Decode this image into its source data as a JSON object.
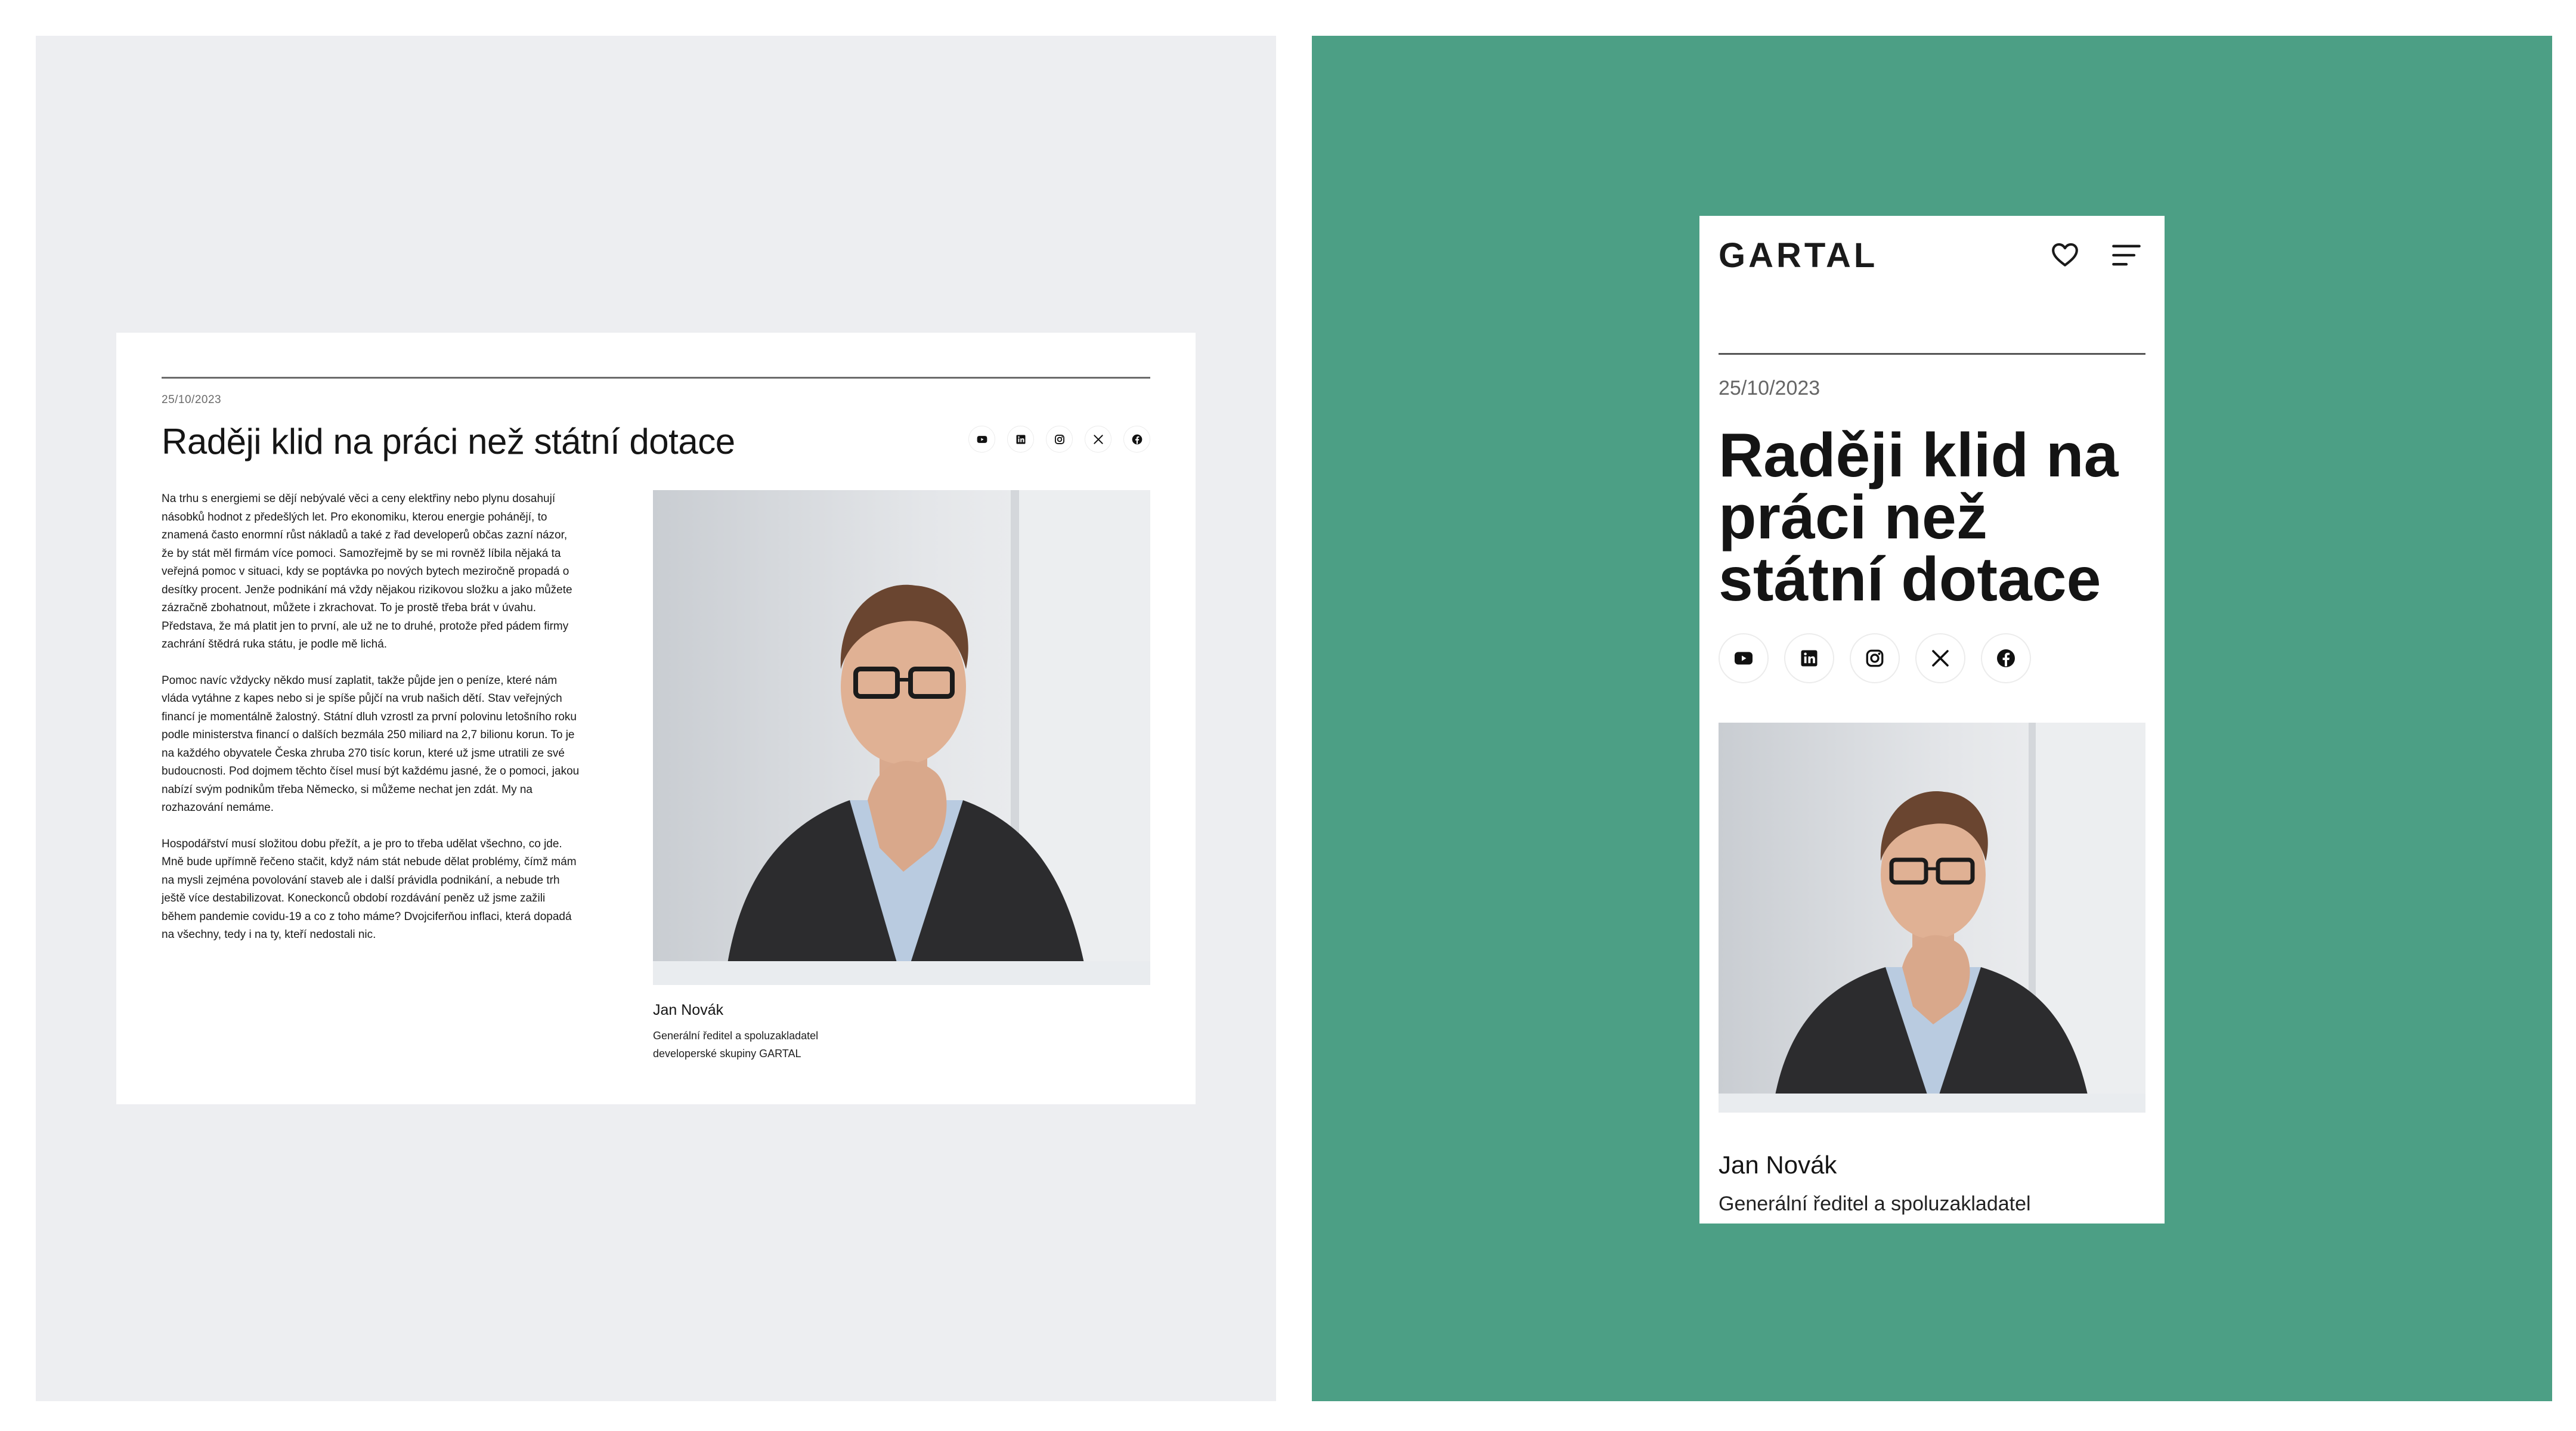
{
  "desktop": {
    "date": "25/10/2023",
    "title": "Raději klid na práci než státní dotace",
    "social": [
      "youtube-icon",
      "linkedin-icon",
      "instagram-icon",
      "x-icon",
      "facebook-icon"
    ],
    "paragraphs": [
      "Na trhu s energiemi se dějí nebývalé věci a ceny elektřiny nebo plynu dosahují násobků hodnot z předešlých let. Pro ekonomiku, kterou energie pohánějí, to znamená často enormní růst nákladů a také z řad developerů občas zazní názor, že by stát měl firmám více pomoci. Samozřejmě by se mi rovněž líbila nějaká ta veřejná pomoc v situaci, kdy se poptávka po nových bytech meziročně propadá o desítky procent. Jenže podnikání má vždy nějakou rizikovou složku a jako můžete zázračně zbohatnout, můžete i zkrachovat. To je prostě třeba brát v úvahu. Představa, že má platit jen to první, ale už ne to druhé, protože před pádem firmy zachrání štědrá ruka státu, je podle mě lichá.",
      "Pomoc navíc vždycky někdo musí zaplatit, takže půjde jen o peníze, které nám vláda vytáhne z kapes nebo si je spíše půjčí na vrub našich dětí. Stav veřejných financí je momentálně žalostný. Státní dluh vzrostl za první polovinu letošního roku podle ministerstva financí o dalších bezmála 250 miliard na 2,7 bilionu korun. To je na každého obyvatele Česka zhruba 270 tisíc korun, které už jsme utratili ze své budoucnosti. Pod dojmem těchto čísel musí být každému jasné, že o pomoci, jakou nabízí svým podnikům třeba Německo, si můžeme nechat jen zdát. My na rozhazování nemáme.",
      "Hospodářství musí složitou dobu přežít, a je pro to třeba udělat všechno, co jde. Mně bude upřímně řečeno stačit, když nám stát nebude dělat problémy, čímž mám na mysli zejména povolování staveb ale i další právidla podnikání, a nebude trh ještě více destabilizovat. Koneckonců období rozdávání peněz už jsme zažili během pandemie covidu-19 a co z toho máme? Dvojciferňou inflaci, která dopadá na všechny, tedy i na ty, kteří nedostali nic."
    ],
    "author_name": "Jan Novák",
    "author_role": "Generální ředitel a spoluzakladatel developerské skupiny GARTAL"
  },
  "mobile": {
    "logo": "GARTAL",
    "date": "25/10/2023",
    "title": "Raději klid na práci než státní dotace",
    "social": [
      "youtube-icon",
      "linkedin-icon",
      "instagram-icon",
      "x-icon",
      "facebook-icon"
    ],
    "author_name": "Jan Novák",
    "author_role": "Generální ředitel a spoluzakladatel"
  },
  "colors": {
    "left_background": "#edeef1",
    "right_background": "#4c9f85",
    "card": "#ffffff",
    "text": "#151515"
  }
}
